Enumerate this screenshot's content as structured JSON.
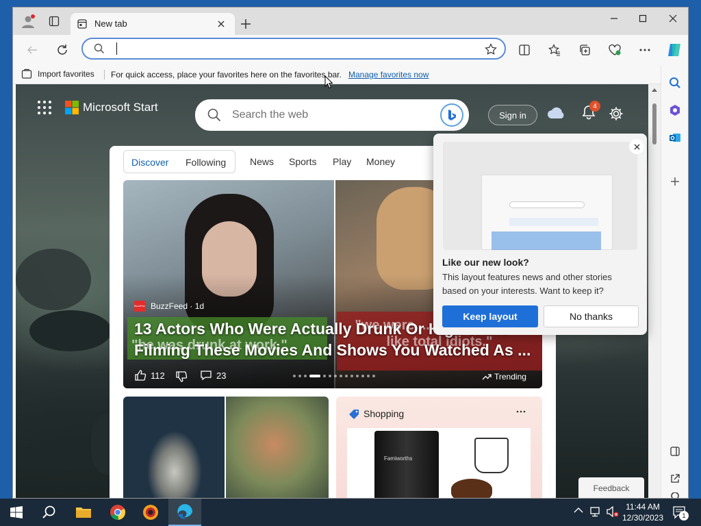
{
  "browser": {
    "tab_title": "New tab",
    "address": {
      "value": "",
      "placeholder": ""
    },
    "favbar": {
      "import_label": "Import favorites",
      "message": "For quick access, place your favorites here on the favorites bar.",
      "manage_link": "Manage favorites now"
    }
  },
  "page": {
    "brand": "Microsoft Start",
    "search_placeholder": "Search the web",
    "signin_label": "Sign in",
    "notification_count": "4",
    "nav": {
      "pills": [
        "Discover",
        "Following"
      ],
      "items": [
        "News",
        "Sports",
        "Play",
        "Money"
      ]
    },
    "hero": {
      "source": "BuzzFeed · 1d",
      "source_logo_text": "BuzzFeed",
      "headline": "13 Actors Who Were Actually Drunk Or High While Filming These Movies And Shows You Watched As ...",
      "overlay_caption_left": "\"he was drunk at work.\"",
      "overlay_caption_right": "\"we were ... around acting like total idiots.\"",
      "likes": "112",
      "comments": "23",
      "trending_label": "Trending",
      "carousel_count": 14,
      "carousel_active_index": 3
    },
    "shopping": {
      "title": "Shopping",
      "product_brand": "Famiworths"
    },
    "feedback_label": "Feedback"
  },
  "popup": {
    "title": "Like our new look?",
    "body": "This layout features news and other stories based on your interests. Want to keep it?",
    "keep_label": "Keep layout",
    "decline_label": "No thanks"
  },
  "taskbar": {
    "time": "11:44 AM",
    "date": "12/30/2023",
    "notification_badge": "1"
  },
  "colors": {
    "accent": "#1f6fd8",
    "taskbar": "#1b2a3a",
    "brand_red": "#f25022",
    "brand_green": "#7fba00",
    "brand_blue": "#00a4ef",
    "brand_yellow": "#ffb900",
    "notification_badge": "#e0502a"
  }
}
